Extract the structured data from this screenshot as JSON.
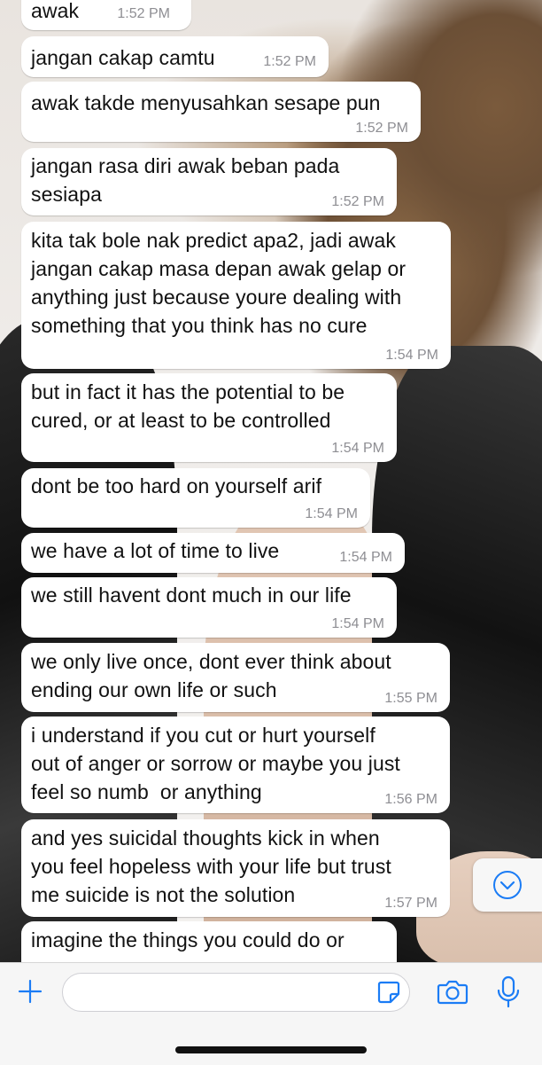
{
  "messages": [
    {
      "text": "awak",
      "time": "1:52 PM"
    },
    {
      "text": "jangan cakap camtu",
      "time": "1:52 PM"
    },
    {
      "text": "awak takde menyusahkan sesape pun",
      "time": "1:52 PM"
    },
    {
      "text": "jangan rasa diri awak beban pada\nsesiapa",
      "time": "1:52 PM"
    },
    {
      "text": "kita tak bole nak predict apa2, jadi awak\njangan cakap masa depan awak gelap or\nanything just because youre dealing with\nsomething that you think has no cure",
      "time": "1:54 PM"
    },
    {
      "text": "but in fact it has the potential to be\ncured, or at least to be controlled",
      "time": "1:54 PM"
    },
    {
      "text": "dont be too hard on yourself arif",
      "time": "1:54 PM"
    },
    {
      "text": "we have a lot of time to live",
      "time": "1:54 PM"
    },
    {
      "text": "we still havent dont much in our life",
      "time": "1:54 PM"
    },
    {
      "text": "we only live once, dont ever think about\nending our own life or such",
      "time": "1:55 PM"
    },
    {
      "text": "i understand if you cut or hurt yourself\nout of anger or sorrow or maybe you just\nfeel so numb  or anything",
      "time": "1:56 PM"
    },
    {
      "text": "and yes suicidal thoughts kick in when\nyou feel hopeless with your life but trust\nme suicide is not the solution",
      "time": "1:57 PM"
    },
    {
      "text": "imagine the things you could do or",
      "time": ""
    }
  ],
  "composer": {
    "placeholder": ""
  },
  "icons": {
    "add": "plus-icon",
    "sticker": "sticker-icon",
    "camera": "camera-icon",
    "mic": "microphone-icon",
    "scroll": "chevron-down-icon"
  },
  "colors": {
    "accent": "#1b7cf5",
    "bubble": "#ffffff",
    "time": "#8e8e93"
  }
}
